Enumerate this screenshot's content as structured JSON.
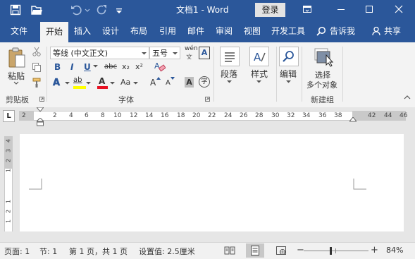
{
  "window": {
    "title": "文档1 - Word",
    "login_label": "登录",
    "controls": [
      "restore-ribbon",
      "minimize",
      "maximize",
      "close"
    ]
  },
  "tabs": [
    {
      "label": "文件"
    },
    {
      "label": "开始"
    },
    {
      "label": "插入"
    },
    {
      "label": "设计"
    },
    {
      "label": "布局"
    },
    {
      "label": "引用"
    },
    {
      "label": "邮件"
    },
    {
      "label": "审阅"
    },
    {
      "label": "视图"
    },
    {
      "label": "开发工具"
    }
  ],
  "tell_me": "告诉我",
  "share": "共享",
  "ribbon": {
    "clipboard": {
      "paste": "粘贴",
      "group": "剪贴板"
    },
    "font": {
      "font_name": "等线 (中文正文)",
      "font_size": "五号",
      "phonetic": "wén",
      "char_border": "A",
      "bold": "B",
      "italic": "I",
      "underline": "U",
      "strike": "abc",
      "sub": "x₂",
      "sup": "x²",
      "text_effect": "A",
      "highlight": "ab",
      "font_color": "A",
      "change_case": "Aa",
      "grow": "A",
      "shrink": "A",
      "char_shading": "A",
      "enclose": "字",
      "group": "字体"
    },
    "paragraph": {
      "label": "段落"
    },
    "styles": {
      "label": "样式"
    },
    "editing": {
      "label": "编辑"
    },
    "new_group": {
      "line1": "选择",
      "line2": "多个对象",
      "group": "新建组"
    }
  },
  "ruler": {
    "tab_selector": "L",
    "h_ticks": [
      "2",
      "2",
      "4",
      "6",
      "8",
      "10",
      "12",
      "14",
      "16",
      "18",
      "20",
      "22",
      "24",
      "26",
      "28",
      "30",
      "32",
      "34",
      "36",
      "38",
      "42",
      "44",
      "46"
    ],
    "v_ticks": [
      "4",
      "3",
      "2",
      "1",
      "1",
      "2",
      "1"
    ]
  },
  "statusbar": {
    "page": "页面: 1",
    "section": "节: 1",
    "page_of": "第 1 页，共 1 页",
    "setting": "设置值: 2.5厘米",
    "zoom": "84%",
    "zoom_level_percent": 84
  },
  "colors": {
    "brand": "#2b579a",
    "highlight": "#ffff00",
    "font_color": "#e81123"
  }
}
